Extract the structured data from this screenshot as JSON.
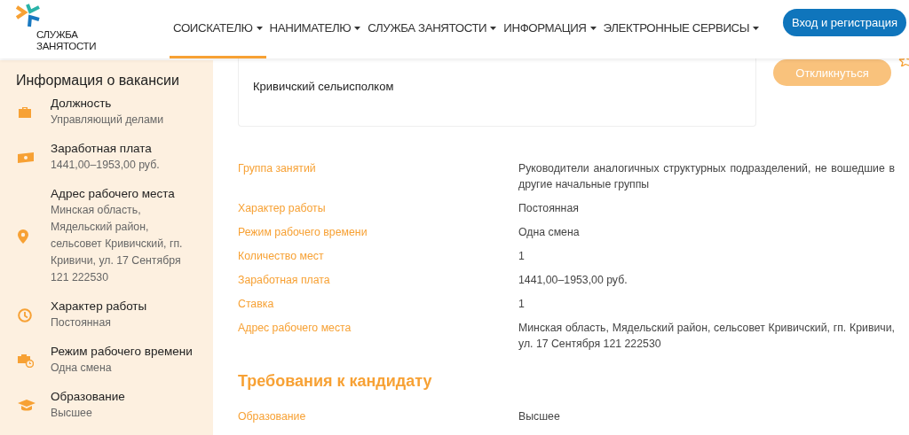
{
  "header": {
    "logo_lines": [
      "СЛУЖБА",
      "ЗАНЯТОСТИ"
    ],
    "nav": [
      {
        "label": "СОИСКАТЕЛЮ",
        "selected": true
      },
      {
        "label": "НАНИМАТЕЛЮ",
        "selected": false
      },
      {
        "label": "СЛУЖБА ЗАНЯТОСТИ",
        "selected": false
      },
      {
        "label": "ИНФОРМАЦИЯ",
        "selected": false
      },
      {
        "label": "ЭЛЕКТРОННЫЕ СЕРВИСЫ",
        "selected": false
      }
    ],
    "login_button": "Вход и регистрация"
  },
  "sidebar": {
    "title": "Информация о вакансии",
    "items": [
      {
        "kind": "briefcase",
        "label": "Должность",
        "value": "Управляющий делами"
      },
      {
        "kind": "money",
        "label": "Заработная плата",
        "value": "1441,00–1953,00 руб."
      },
      {
        "kind": "pin",
        "label": "Адрес рабочего места",
        "value": "Минская область, Мядельский район, сельсовет Кривичский, гп. Кривичи, ул. 17 Сентября 121 222530"
      },
      {
        "kind": "clock",
        "label": "Характер работы",
        "value": "Постоянная"
      },
      {
        "kind": "schedule",
        "label": "Режим рабочего времени",
        "value": "Одна смена"
      },
      {
        "kind": "education",
        "label": "Образование",
        "value": "Высшее"
      }
    ]
  },
  "employer_card": {
    "name": "Кривичский сельисполком"
  },
  "respond_button": "Откликнуться",
  "details": [
    {
      "label": "Группа занятий",
      "value": "Руководители аналогичных структурных подразделений, не вошедшие в другие начальные группы"
    },
    {
      "label": "Характер работы",
      "value": "Постоянная"
    },
    {
      "label": "Режим рабочего времени",
      "value": "Одна смена"
    },
    {
      "label": "Количество мест",
      "value": "1"
    },
    {
      "label": "Заработная плата",
      "value": "1441,00–1953,00 руб."
    },
    {
      "label": "Ставка",
      "value": "1"
    },
    {
      "label": "Адрес рабочего места",
      "value": "Минская область, Мядельский район, сельсовет Кривичский, гп. Кривичи, ул. 17 Сентября 121 222530"
    }
  ],
  "requirements": {
    "title": "Требования к кандидату",
    "rows": [
      {
        "label": "Образование",
        "value": "Высшее"
      }
    ]
  }
}
